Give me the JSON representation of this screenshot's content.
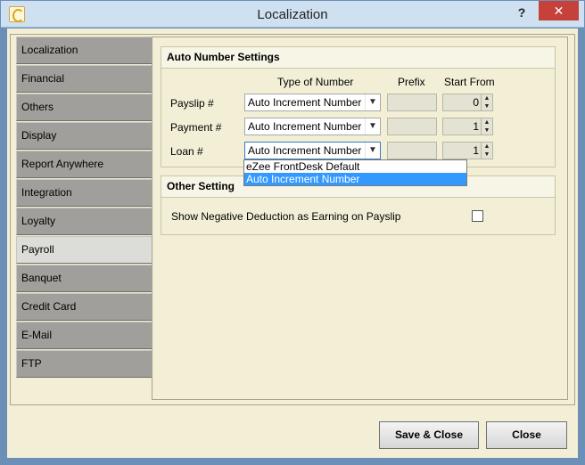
{
  "window": {
    "title": "Localization",
    "help": "?",
    "close": "✕"
  },
  "nav": {
    "items": [
      "Localization",
      "Financial",
      "Others",
      "Display",
      "Report Anywhere",
      "Integration",
      "Loyalty",
      "Payroll",
      "Banquet",
      "Credit Card",
      "E-Mail",
      "FTP"
    ],
    "active": "Payroll"
  },
  "auto_number": {
    "title": "Auto Number Settings",
    "col_type": "Type of Number",
    "col_prefix": "Prefix",
    "col_start": "Start From",
    "rows": [
      {
        "label": "Payslip #",
        "type": "Auto Increment Number",
        "prefix": "",
        "start": "0"
      },
      {
        "label": "Payment #",
        "type": "Auto Increment Number",
        "prefix": "",
        "start": "1"
      },
      {
        "label": "Loan #",
        "type": "Auto Increment Number",
        "prefix": "",
        "start": "1"
      }
    ],
    "dropdown_options": [
      "eZee FrontDesk Default",
      "Auto Increment Number"
    ],
    "dropdown_selected": "Auto Increment Number"
  },
  "other": {
    "title": "Other Setting",
    "negative_deduction_label": "Show Negative Deduction as Earning on Payslip",
    "negative_deduction_checked": false
  },
  "footer": {
    "save_label": "Save & Close",
    "close_label": "Close"
  }
}
